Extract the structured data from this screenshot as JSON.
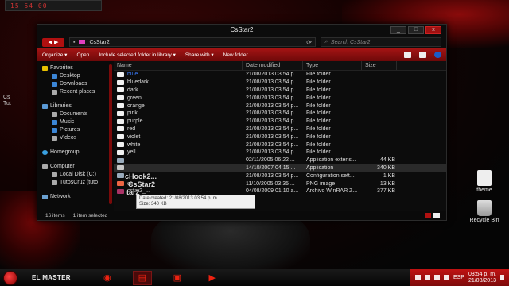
{
  "gadget": {
    "text": "15 54 00"
  },
  "side_label": {
    "line1": "Cs",
    "line2": "Tut"
  },
  "window": {
    "title": "CsStar2",
    "min": "_",
    "max": "□",
    "close": "x"
  },
  "address": {
    "path": "CsStar2",
    "search_placeholder": "Search CsStar2"
  },
  "toolbar": {
    "organize": "Organize ▾",
    "open": "Open",
    "include": "Include selected folder in library ▾",
    "share": "Share with ▾",
    "new_folder": "New folder"
  },
  "nav": {
    "favorites": "Favorites",
    "desktop": "Desktop",
    "downloads": "Downloads",
    "recent": "Recent places",
    "libraries": "Libraries",
    "documents": "Documents",
    "music": "Music",
    "pictures": "Pictures",
    "videos": "Videos",
    "homegroup": "Homegroup",
    "computer": "Computer",
    "local_disk": "Local Disk (C:)",
    "tutos": "TutosCruz (tuto",
    "network": "Network"
  },
  "columns": {
    "name": "Name",
    "date": "Date modified",
    "type": "Type",
    "size": "Size"
  },
  "files": [
    {
      "name": "blue",
      "date": "21/08/2013 03:54 p...",
      "type": "File folder",
      "size": ""
    },
    {
      "name": "bluedark",
      "date": "21/08/2013 03:54 p...",
      "type": "File folder",
      "size": ""
    },
    {
      "name": "dark",
      "date": "21/08/2013 03:54 p...",
      "type": "File folder",
      "size": ""
    },
    {
      "name": "green",
      "date": "21/08/2013 03:54 p...",
      "type": "File folder",
      "size": ""
    },
    {
      "name": "orange",
      "date": "21/08/2013 03:54 p...",
      "type": "File folder",
      "size": ""
    },
    {
      "name": "pink",
      "date": "21/08/2013 03:54 p...",
      "type": "File folder",
      "size": ""
    },
    {
      "name": "purple",
      "date": "21/08/2013 03:54 p...",
      "type": "File folder",
      "size": ""
    },
    {
      "name": "red",
      "date": "21/08/2013 03:54 p...",
      "type": "File folder",
      "size": ""
    },
    {
      "name": "violet",
      "date": "21/08/2013 03:54 p...",
      "type": "File folder",
      "size": ""
    },
    {
      "name": "white",
      "date": "21/08/2013 03:54 p...",
      "type": "File folder",
      "size": ""
    },
    {
      "name": "yell",
      "date": "21/08/2013 03:54 p...",
      "type": "File folder",
      "size": ""
    },
    {
      "name": "",
      "date": "02/11/2005 06:22 ...",
      "type": "Application extens...",
      "size": "44 KB"
    },
    {
      "name": "",
      "date": "14/10/2007 04:15 ...",
      "type": "Application",
      "size": "340 KB"
    },
    {
      "name": "",
      "date": "21/08/2013 03:54 p...",
      "type": "Configuration sett...",
      "size": "1 KB"
    },
    {
      "name": "cs",
      "date": "11/10/2005 03:35 ...",
      "type": "PNG image",
      "size": "13 KB"
    },
    {
      "name": "cstar2_...",
      "date": "04/08/2009 01:10 a...",
      "type": "Archivo WinRAR Z...",
      "size": "377 KB"
    }
  ],
  "drag": {
    "ghost1": "cHook2...",
    "ghost2": "CsStar2",
    "ghost3": "tar2"
  },
  "tooltip": {
    "line1": "Date created: 21/08/2013 03:54 p. m.",
    "line2": "Size: 340 KB"
  },
  "status": {
    "items": "16 items",
    "selected": "1 item selected"
  },
  "desktop_icons": {
    "theme": "theme",
    "bin": "Recycle Bin"
  },
  "taskbar": {
    "label": "EL MASTER",
    "lang": "ESP",
    "time": "03:54 p. m.",
    "date": "21/08/2013"
  }
}
